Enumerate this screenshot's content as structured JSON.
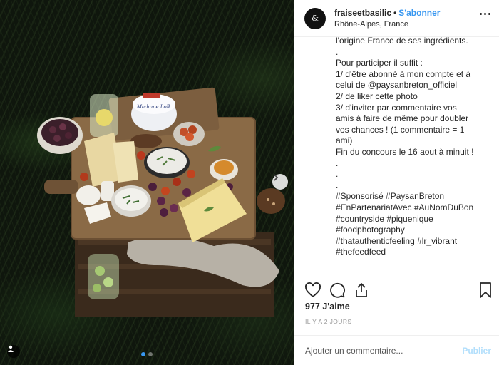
{
  "post": {
    "username": "fraiseetbasilic",
    "separator": "•",
    "follow_label": "S'abonner",
    "location": "Rhône-Alpes, France",
    "avatar_text": "&",
    "caption_lines": [
      "l'origine France de ses ingrédients.",
      ".",
      "Pour participer il suffit :",
      "1/ d'être abonné à mon compte et à",
      "celui de @paysanbreton_officiel",
      "2/ de liker cette photo",
      "3/ d'inviter par commentaire vos",
      "amis à faire de même pour doubler",
      "vos chances ! (1 commentaire = 1",
      "ami)",
      "Fin du concours le 16 aout à minuit !",
      ".",
      ".",
      ".",
      "#Sponsorisé #PaysanBreton",
      "#EnPartenariatAvec #AuNomDuBon",
      "#countryside #piquenique",
      "#foodphotography",
      "#thatauthenticfeeling #lr_vibrant",
      "#thefeedfeed"
    ],
    "likes": "977 J'aime",
    "date": "IL Y A 2 JOURS",
    "comment_placeholder": "Ajouter un commentaire...",
    "publish_label": "Publier"
  },
  "photo": {
    "cheese_label": "Madame Loïk",
    "cheese_brand": "PAYSAN BRETON",
    "carousel_count": 2,
    "carousel_active": 1
  },
  "icons": {
    "like": "heart-icon",
    "comment": "comment-icon",
    "share": "share-icon",
    "save": "bookmark-icon",
    "more": "more-options-icon",
    "next": "chevron-right-icon",
    "tag": "user-tag-icon"
  },
  "colors": {
    "link_blue": "#3897f0",
    "publish_disabled": "#b2dffc",
    "text": "#262626",
    "muted": "#999999"
  }
}
